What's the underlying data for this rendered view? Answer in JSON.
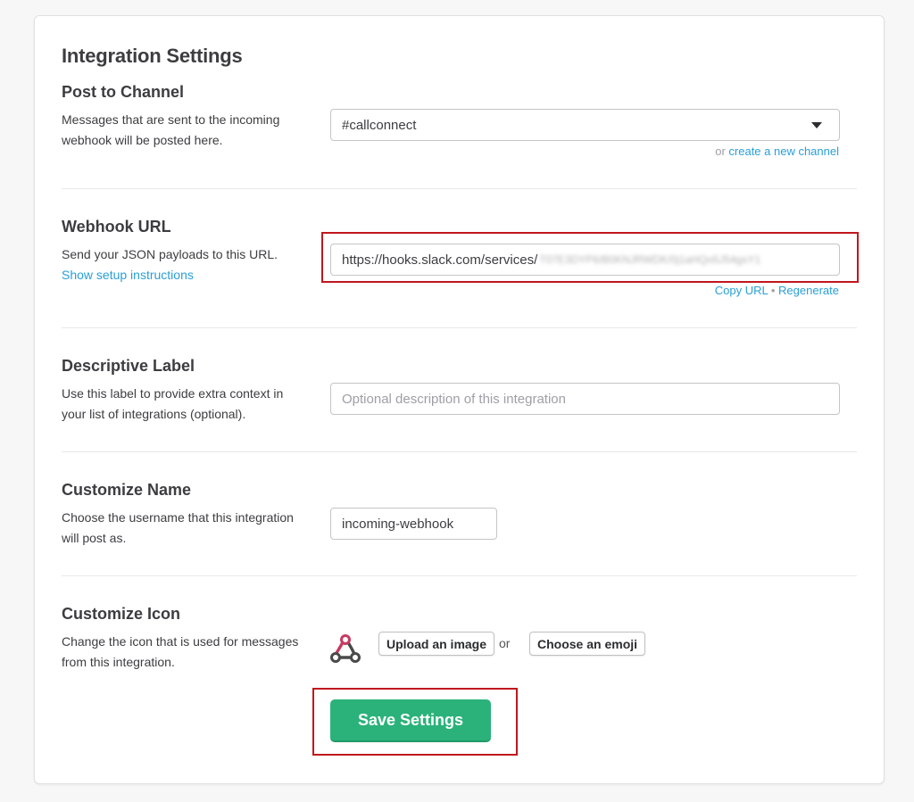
{
  "page": {
    "title": "Integration Settings"
  },
  "post_channel": {
    "title": "Post to Channel",
    "description": "Messages that are sent to the incoming webhook will be posted here.",
    "selected_channel": "#callconnect",
    "or_text": "or",
    "create_channel_link": "create a new channel"
  },
  "webhook": {
    "title": "Webhook URL",
    "description": "Send your JSON payloads to this URL.",
    "setup_link": "Show setup instructions",
    "url_visible": "https://hooks.slack.com/services/",
    "url_redacted": "T07E3DYP6/B0KNJRWDK/0j1aHQo5J54gsY1",
    "copy_link": "Copy URL",
    "separator": "•",
    "regenerate_link": "Regenerate"
  },
  "label": {
    "title": "Descriptive Label",
    "description": "Use this label to provide extra context in your list of integrations (optional).",
    "placeholder": "Optional description of this integration"
  },
  "name": {
    "title": "Customize Name",
    "description": "Choose the username that this integration will post as.",
    "value": "incoming-webhook"
  },
  "icon": {
    "title": "Customize Icon",
    "description": "Change the icon that is used for messages from this integration.",
    "icon_name": "webhook-icon",
    "upload_label": "Upload an image",
    "or_text": "or",
    "emoji_label": "Choose an emoji"
  },
  "save": {
    "label": "Save Settings"
  },
  "colors": {
    "accent_green": "#2bb27a",
    "link_blue": "#2a9fd6",
    "highlight_red": "#c0171d",
    "webhook_pink": "#c73a63"
  }
}
